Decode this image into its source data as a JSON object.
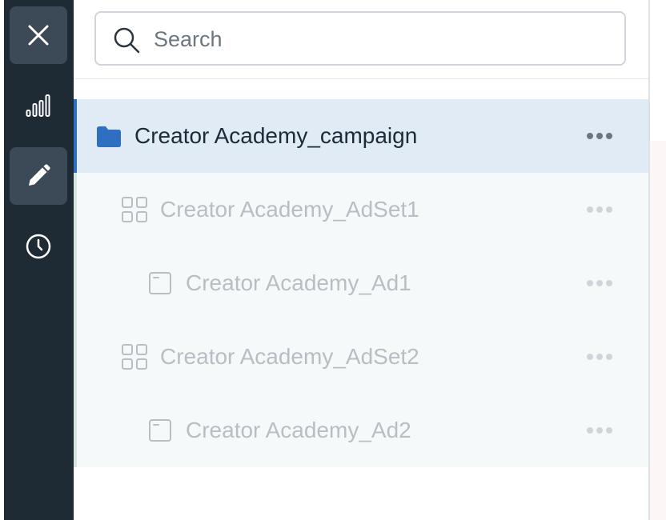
{
  "sidebar": {
    "buttons": [
      {
        "name": "close",
        "icon": "close-icon"
      },
      {
        "name": "reporting",
        "icon": "bar-chart-icon"
      },
      {
        "name": "edit",
        "icon": "pencil-icon",
        "active": true
      },
      {
        "name": "history",
        "icon": "clock-icon"
      }
    ]
  },
  "search": {
    "placeholder": "Search",
    "value": ""
  },
  "tree": {
    "items": [
      {
        "label": "Creator Academy_campaign",
        "type": "campaign",
        "icon": "folder-icon",
        "selected": true
      },
      {
        "label": "Creator Academy_AdSet1",
        "type": "ad-set",
        "icon": "grid-icon",
        "selected": false
      },
      {
        "label": "Creator Academy_Ad1",
        "type": "ad",
        "icon": "ad-window-icon",
        "selected": false
      },
      {
        "label": "Creator Academy_AdSet2",
        "type": "ad-set",
        "icon": "grid-icon",
        "selected": false
      },
      {
        "label": "Creator Academy_Ad2",
        "type": "ad",
        "icon": "ad-window-icon",
        "selected": false
      }
    ]
  },
  "colors": {
    "rail": "#1e2b34",
    "rail_active": "#3b4a56",
    "selected_row": "#e1ebf5",
    "accent": "#2f6fc1",
    "dim_text": "#b8bec4"
  }
}
